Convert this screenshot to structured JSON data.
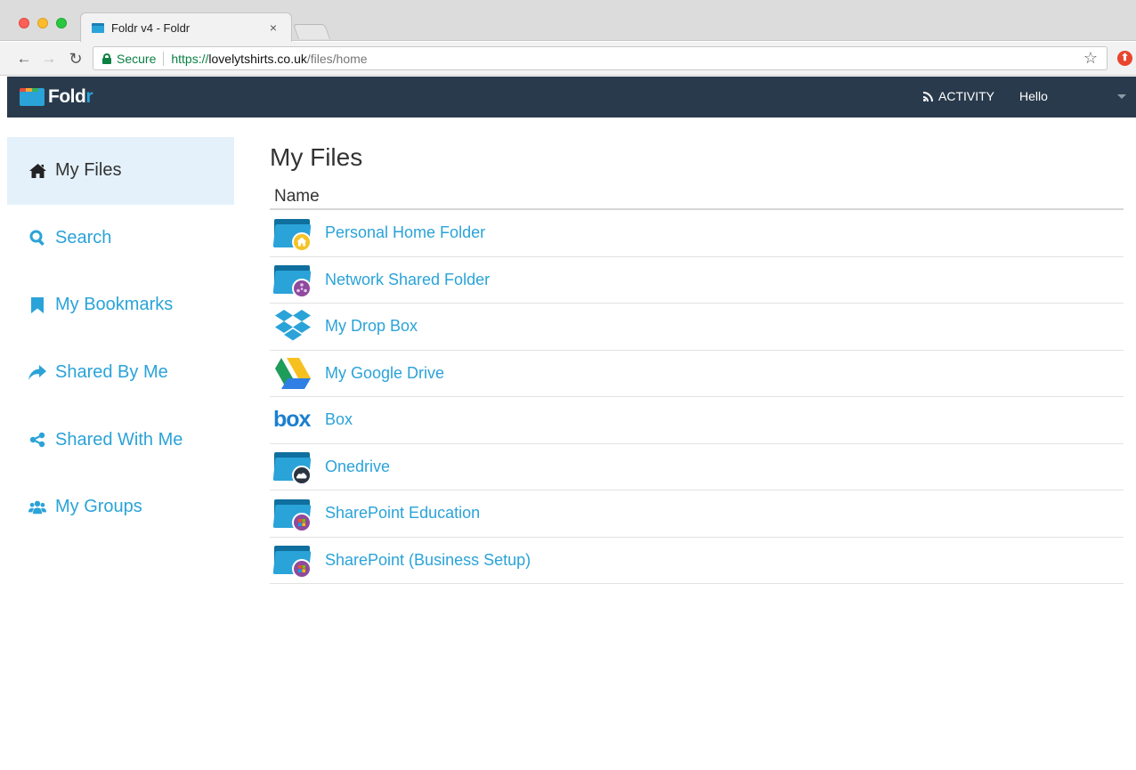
{
  "browser": {
    "tab_title": "Foldr v4 - Foldr",
    "tab_close": "×",
    "secure_label": "Secure",
    "url_scheme": "https://",
    "url_host": "lovelytshirts.co.uk",
    "url_path": "/files/home",
    "back_glyph": "←",
    "forward_glyph": "→",
    "reload_glyph": "↻",
    "star_glyph": "☆"
  },
  "header": {
    "logo_main": "Fold",
    "logo_accent": "r",
    "activity_label": "ACTIVITY",
    "greeting": "Hello"
  },
  "sidebar": {
    "items": [
      {
        "label": "My Files",
        "icon": "home-icon",
        "active": true
      },
      {
        "label": "Search",
        "icon": "search-icon",
        "active": false
      },
      {
        "label": "My Bookmarks",
        "icon": "bookmark-icon",
        "active": false
      },
      {
        "label": "Shared By Me",
        "icon": "share-arrow-icon",
        "active": false
      },
      {
        "label": "Shared With Me",
        "icon": "share-nodes-icon",
        "active": false
      },
      {
        "label": "My Groups",
        "icon": "users-icon",
        "active": false
      }
    ]
  },
  "main": {
    "title": "My Files",
    "column_header": "Name",
    "files": [
      {
        "name": "Personal Home Folder",
        "icon": "home-folder-icon"
      },
      {
        "name": "Network Shared Folder",
        "icon": "network-folder-icon"
      },
      {
        "name": "My Drop Box",
        "icon": "dropbox-icon"
      },
      {
        "name": "My Google Drive",
        "icon": "google-drive-icon"
      },
      {
        "name": "Box",
        "icon": "box-icon",
        "icon_text": "box"
      },
      {
        "name": "Onedrive",
        "icon": "onedrive-folder-icon"
      },
      {
        "name": "SharePoint Education",
        "icon": "sharepoint-folder-icon"
      },
      {
        "name": "SharePoint (Business Setup)",
        "icon": "sharepoint-folder-icon"
      }
    ]
  },
  "colors": {
    "accent": "#2aa3d8",
    "header_bg": "#293a4c",
    "active_bg": "#e4f1fb",
    "secure_green": "#0b8043"
  }
}
